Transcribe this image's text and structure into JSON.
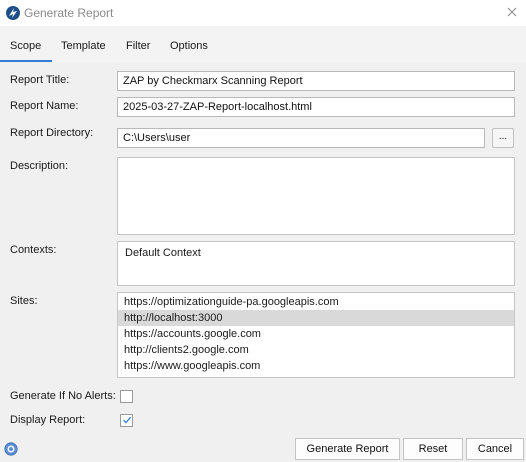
{
  "window": {
    "title": "Generate Report"
  },
  "tabs": [
    {
      "label": "Scope"
    },
    {
      "label": "Template"
    },
    {
      "label": "Filter"
    },
    {
      "label": "Options"
    }
  ],
  "form": {
    "report_title_label": "Report Title:",
    "report_title_value": "ZAP by Checkmarx Scanning Report",
    "report_name_label": "Report Name:",
    "report_name_value": "2025-03-27-ZAP-Report-localhost.html",
    "report_directory_label": "Report Directory:",
    "report_directory_value": "C:\\Users\\user",
    "browse_label": "...",
    "description_label": "Description:",
    "description_value": "",
    "contexts_label": "Contexts:",
    "contexts": [
      "Default Context"
    ],
    "sites_label": "Sites:",
    "sites": [
      "https://optimizationguide-pa.googleapis.com",
      "http://localhost:3000",
      "https://accounts.google.com",
      "http://clients2.google.com",
      "https://www.googleapis.com"
    ],
    "selected_site": "http://localhost:3000",
    "generate_if_no_alerts_label": "Generate If No Alerts:",
    "generate_if_no_alerts_checked": false,
    "display_report_label": "Display Report:",
    "display_report_checked": true
  },
  "buttons": {
    "generate": "Generate Report",
    "reset": "Reset",
    "cancel": "Cancel"
  },
  "colors": {
    "accent": "#2f7fd6",
    "selection": "#d9d9d9",
    "app_icon": "#1f4f8b"
  },
  "icons": {
    "app": "zap-logo-icon",
    "close": "close-icon",
    "help": "help-icon",
    "check": "checkmark-icon"
  }
}
